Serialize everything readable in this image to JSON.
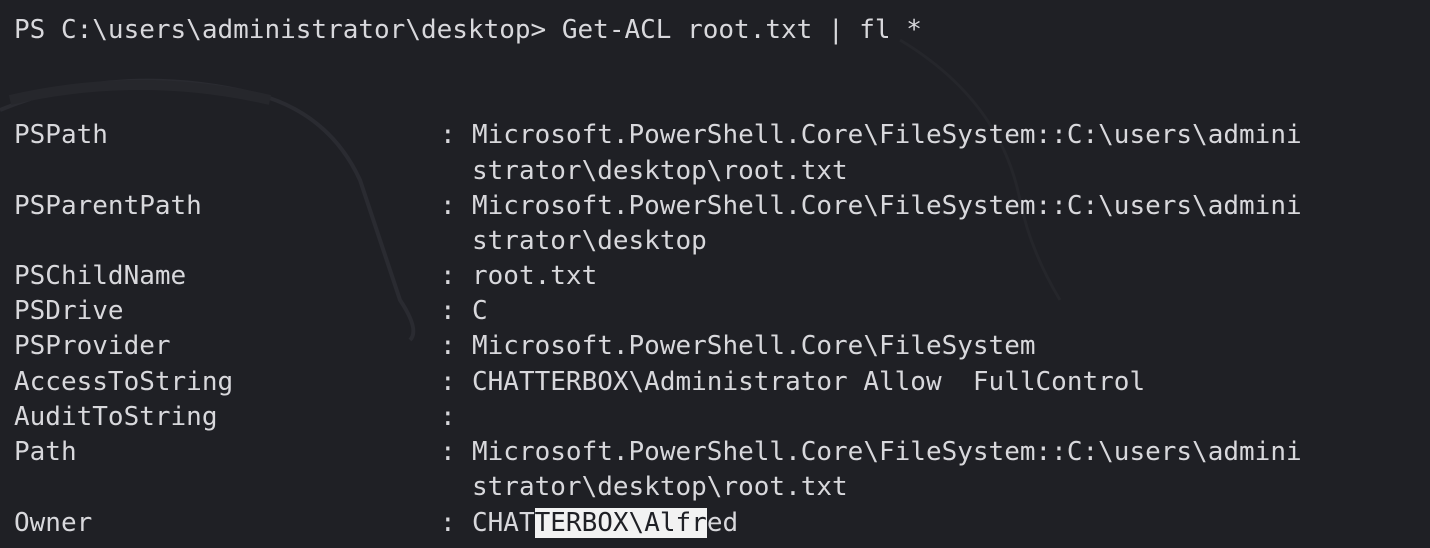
{
  "prompt": "PS C:\\users\\administrator\\desktop> Get-ACL root.txt | fl *",
  "rows": [
    {
      "key": "PSPath",
      "value": [
        "Microsoft.PowerShell.Core\\FileSystem::C:\\users\\admini",
        "strator\\desktop\\root.txt"
      ]
    },
    {
      "key": "PSParentPath",
      "value": [
        "Microsoft.PowerShell.Core\\FileSystem::C:\\users\\admini",
        "strator\\desktop"
      ]
    },
    {
      "key": "PSChildName",
      "value": [
        "root.txt"
      ]
    },
    {
      "key": "PSDrive",
      "value": [
        "C"
      ]
    },
    {
      "key": "PSProvider",
      "value": [
        "Microsoft.PowerShell.Core\\FileSystem"
      ]
    },
    {
      "key": "AccessToString",
      "value": [
        "CHATTERBOX\\Administrator Allow  FullControl"
      ]
    },
    {
      "key": "AuditToString",
      "value": [
        ""
      ]
    },
    {
      "key": "Path",
      "value": [
        "Microsoft.PowerShell.Core\\FileSystem::C:\\users\\admini",
        "strator\\desktop\\root.txt"
      ]
    },
    {
      "key": "Owner",
      "value_parts": {
        "before": "CHAT",
        "selected": "TERBOX\\Alfr",
        "after": "ed"
      }
    }
  ],
  "colors": {
    "background": "#1f2025",
    "text": "#d8d8dc",
    "selection_bg": "#f2f2f2",
    "selection_fg": "#1f2025"
  }
}
